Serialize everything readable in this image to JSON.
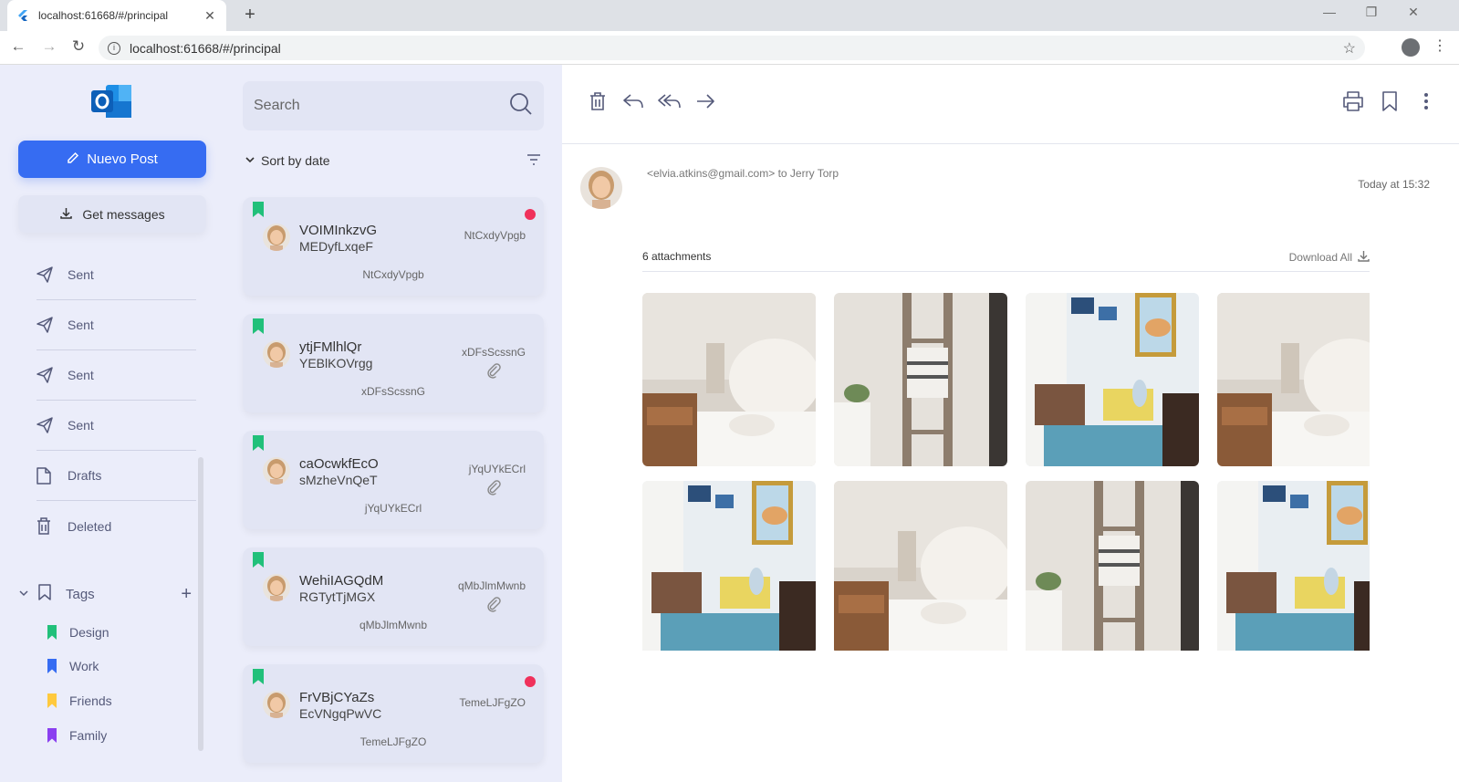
{
  "browser": {
    "tab_title": "localhost:61668/#/principal",
    "url": "localhost:61668/#/principal"
  },
  "sidebar": {
    "new_post_label": "Nuevo Post",
    "get_messages_label": "Get messages",
    "folders": [
      {
        "label": "Sent",
        "icon": "send-icon"
      },
      {
        "label": "Sent",
        "icon": "send-icon"
      },
      {
        "label": "Sent",
        "icon": "send-icon"
      },
      {
        "label": "Sent",
        "icon": "send-icon"
      },
      {
        "label": "Drafts",
        "icon": "document-icon"
      },
      {
        "label": "Deleted",
        "icon": "trash-icon"
      }
    ],
    "tags_label": "Tags",
    "tags": [
      {
        "label": "Design",
        "color": "#21c07a"
      },
      {
        "label": "Work",
        "color": "#366cf2"
      },
      {
        "label": "Friends",
        "color": "#ffc93d"
      },
      {
        "label": "Family",
        "color": "#8a3ff0"
      }
    ]
  },
  "list": {
    "search_placeholder": "Search",
    "sort_label": "Sort by date",
    "messages": [
      {
        "name": "VOIMInkzvG",
        "subject": "MEDyfLxqeF",
        "right": "NtCxdyVpgb",
        "bottom": "NtCxdyVpgb",
        "unread": true,
        "attachment": false
      },
      {
        "name": "ytjFMlhlQr",
        "subject": "YEBlKOVrgg",
        "right": "xDFsScssnG",
        "bottom": "xDFsScssnG",
        "unread": false,
        "attachment": true
      },
      {
        "name": "caOcwkfEcO",
        "subject": "sMzheVnQeT",
        "right": "jYqUYkECrl",
        "bottom": "jYqUYkECrl",
        "unread": false,
        "attachment": true
      },
      {
        "name": "WehiIAGQdM",
        "subject": "RGTytTjMGX",
        "right": "qMbJlmMwnb",
        "bottom": "qMbJlmMwnb",
        "unread": false,
        "attachment": true
      },
      {
        "name": "FrVBjCYaZs",
        "subject": "EcVNgqPwVC",
        "right": "TemeLJFgZO",
        "bottom": "TemeLJFgZO",
        "unread": true,
        "attachment": false
      }
    ]
  },
  "reader": {
    "sender_line": "<elvia.atkins@gmail.com> to Jerry Torp",
    "time": "Today at 15:32",
    "attachments_count": "6 attachments",
    "download_all_label": "Download All"
  },
  "colors": {
    "accent": "#366cf2",
    "unread_dot": "#f0315b",
    "bookmark": "#21c07a"
  }
}
